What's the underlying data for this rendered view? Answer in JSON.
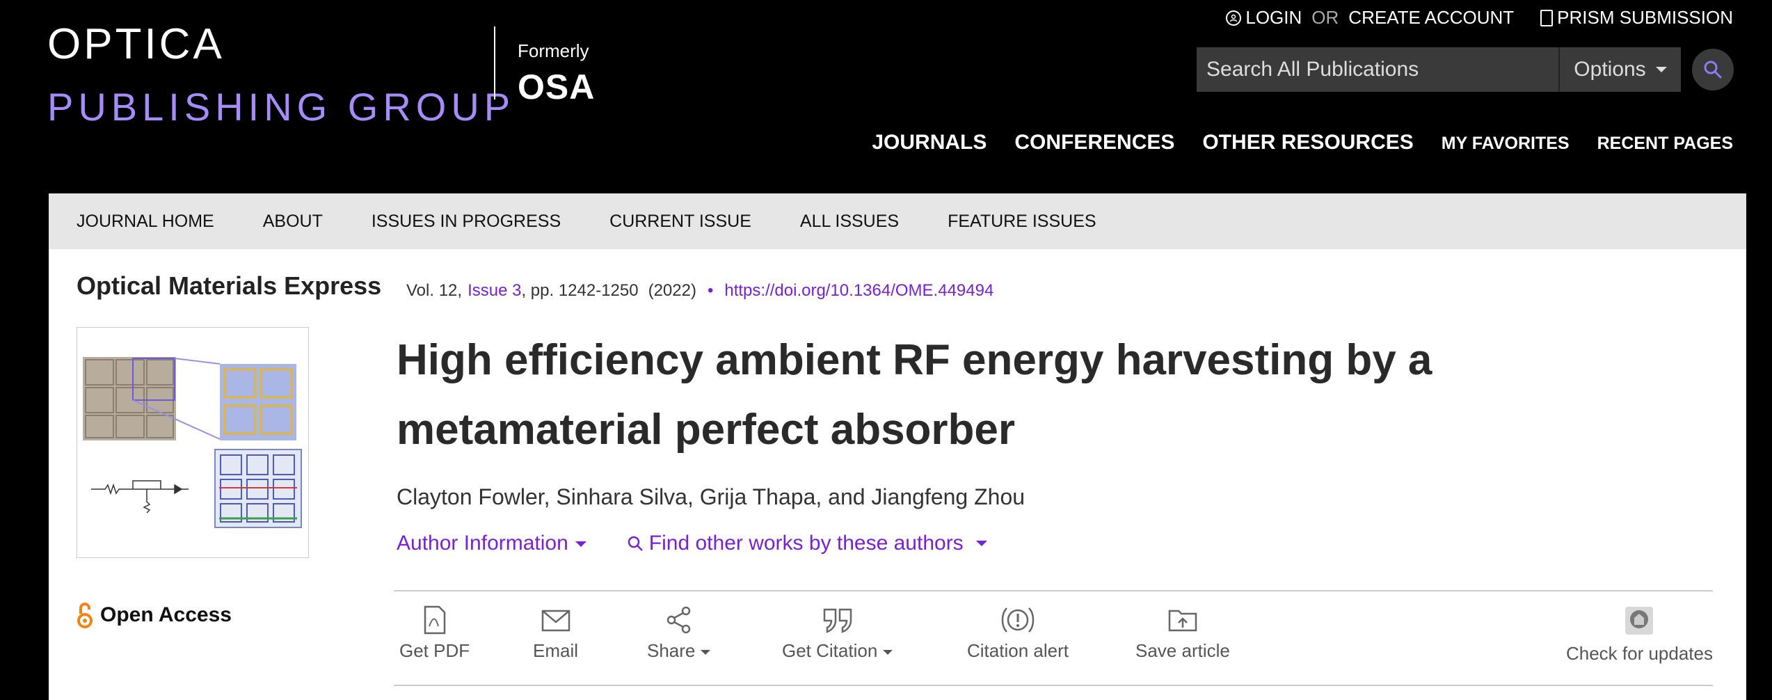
{
  "brand": {
    "logo_top": "OPTICA",
    "logo_bottom": "PUBLISHING GROUP",
    "formerly": "Formerly",
    "former_name": "OSA"
  },
  "account": {
    "login": "LOGIN",
    "or": "OR",
    "create": "CREATE ACCOUNT",
    "prism": "PRISM SUBMISSION"
  },
  "search": {
    "placeholder": "Search All Publications",
    "options_label": "Options"
  },
  "main_nav": {
    "journals": "JOURNALS",
    "conferences": "CONFERENCES",
    "other": "OTHER RESOURCES",
    "favorites": "MY FAVORITES",
    "recent": "RECENT PAGES"
  },
  "sub_nav": [
    "JOURNAL HOME",
    "ABOUT",
    "ISSUES IN PROGRESS",
    "CURRENT ISSUE",
    "ALL ISSUES",
    "FEATURE ISSUES"
  ],
  "article": {
    "journal": "Optical Materials Express",
    "vol": "Vol. 12,",
    "issue": "Issue 3",
    "pages": ", pp. 1242-1250",
    "year": "(2022)",
    "doi": "https://doi.org/10.1364/OME.449494",
    "title": "High efficiency ambient RF energy harvesting by a metamaterial perfect absorber",
    "authors": "Clayton Fowler, Sinhara Silva, Grija Thapa, and Jiangfeng Zhou",
    "author_info": "Author Information",
    "find_works": "Find other works by these authors",
    "open_access": "Open Access"
  },
  "toolbar": {
    "pdf": "Get PDF",
    "email": "Email",
    "share": "Share",
    "citation": "Get Citation",
    "alert": "Citation alert",
    "save": "Save article",
    "updates": "Check for updates"
  },
  "colors": {
    "accent": "#7a1fd6",
    "logo_purple": "#a78bfa",
    "oa_orange": "#f68212"
  }
}
